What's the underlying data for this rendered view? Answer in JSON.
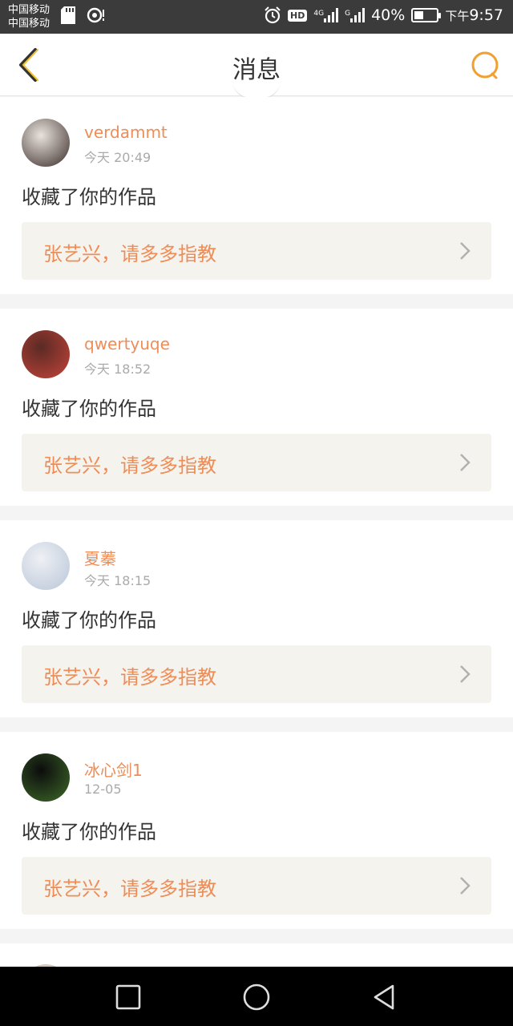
{
  "status_bar": {
    "carrier_line1": "中国移动",
    "carrier_line2": "中国移动",
    "hd": "HD",
    "net1": "4G",
    "net2": "G",
    "battery_percent": "40%",
    "battery_level": 0.4,
    "time_prefix": "下午",
    "time": "9:57"
  },
  "header": {
    "title": "消息",
    "accent_color": "#f0a030"
  },
  "messages": [
    {
      "username": "verdammt",
      "time": "今天 20:49",
      "action": "收藏了你的作品",
      "work_title": "张艺兴，请多多指教",
      "avatar_colors": [
        "#e9e3dc",
        "#3a2c2a"
      ]
    },
    {
      "username": "qwertyuqe",
      "time": "今天 18:52",
      "action": "收藏了你的作品",
      "work_title": "张艺兴，请多多指教",
      "avatar_colors": [
        "#5a2a24",
        "#c4443a"
      ]
    },
    {
      "username": "夏蓁",
      "time": "今天 18:15",
      "action": "收藏了你的作品",
      "work_title": "张艺兴，请多多指教",
      "avatar_colors": [
        "#eef0f4",
        "#b9c6d8"
      ]
    },
    {
      "username": "冰心剑1",
      "time": "12-05",
      "action": "收藏了你的作品",
      "work_title": "张艺兴，请多多指教",
      "avatar_colors": [
        "#0c0c0c",
        "#3e6a2a"
      ]
    }
  ],
  "colors": {
    "username": "#f08c55",
    "work_bg": "#f4f3ee",
    "page_bg": "#f4f4f4"
  }
}
